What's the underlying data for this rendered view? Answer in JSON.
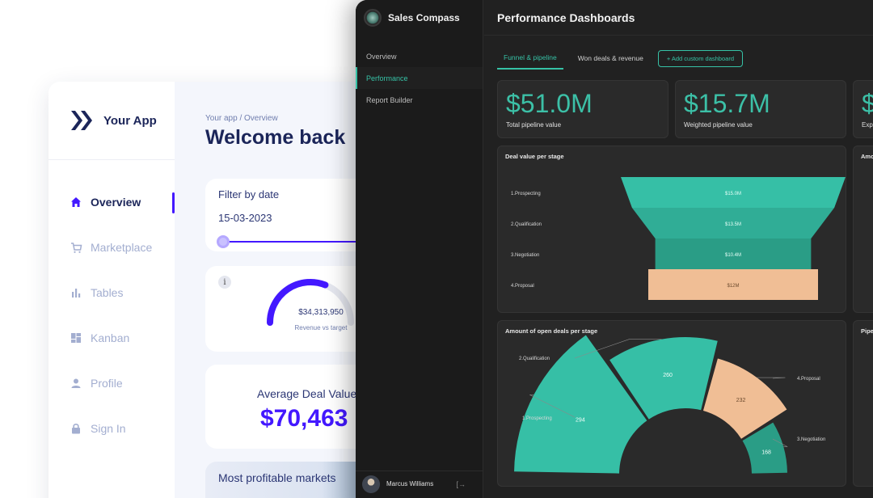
{
  "light_app": {
    "brand": "Your App",
    "nav": [
      {
        "label": "Overview",
        "icon": "home-icon",
        "active": true
      },
      {
        "label": "Marketplace",
        "icon": "cart-icon"
      },
      {
        "label": "Tables",
        "icon": "bar-chart-icon"
      },
      {
        "label": "Kanban",
        "icon": "dashboard-icon"
      },
      {
        "label": "Profile",
        "icon": "person-icon"
      },
      {
        "label": "Sign In",
        "icon": "lock-icon"
      }
    ],
    "breadcrumb": "Your app / Overview",
    "title": "Welcome back",
    "filter": {
      "title": "Filter by date",
      "date": "15-03-2023"
    },
    "gauge": {
      "value": "$34,313,950",
      "label": "Revenue vs target",
      "fraction": 0.62
    },
    "deal": {
      "title": "Average Deal Value",
      "value": "$70,463"
    },
    "markets": {
      "title": "Most profitable markets"
    },
    "colors": {
      "accent": "#4318ff",
      "text": "#1b2559"
    }
  },
  "dark_app": {
    "brand": "Sales Compass",
    "nav": [
      {
        "label": "Overview"
      },
      {
        "label": "Performance",
        "active": true
      },
      {
        "label": "Report Builder"
      }
    ],
    "user": {
      "name": "Marcus Williams"
    },
    "title": "Performance Dashboards",
    "tabs": [
      {
        "label": "Funnel & pipeline",
        "active": true
      },
      {
        "label": "Won deals & revenue"
      }
    ],
    "add_button": "+ Add custom dashboard",
    "kpis": [
      {
        "value": "$51.0M",
        "label": "Total pipeline value"
      },
      {
        "value": "$15.7M",
        "label": "Weighted pipeline value"
      },
      {
        "value": "$",
        "label": "Exp"
      }
    ],
    "side_panels": {
      "top": "Amo",
      "bottom": "Pipe"
    },
    "colors": {
      "teal": "#36c2a6",
      "teal_dark": "#2a9d86",
      "peach": "#f0be95"
    }
  },
  "chart_data": [
    {
      "type": "funnel",
      "title": "Deal value per stage",
      "categories": [
        "1.Prospecting",
        "2.Qualification",
        "3.Negotiation",
        "4.Proposal"
      ],
      "values": [
        15.0,
        13.5,
        10.4,
        12.0
      ],
      "labels": [
        "$15.0M",
        "$13.5M",
        "$10.4M",
        "$12M"
      ]
    },
    {
      "type": "pie",
      "title": "Amount of open deals per stage",
      "categories": [
        "1.Prospecting",
        "2.Qualification",
        "4.Proposal",
        "3.Negotiation"
      ],
      "values": [
        294,
        260,
        232,
        168
      ]
    }
  ]
}
